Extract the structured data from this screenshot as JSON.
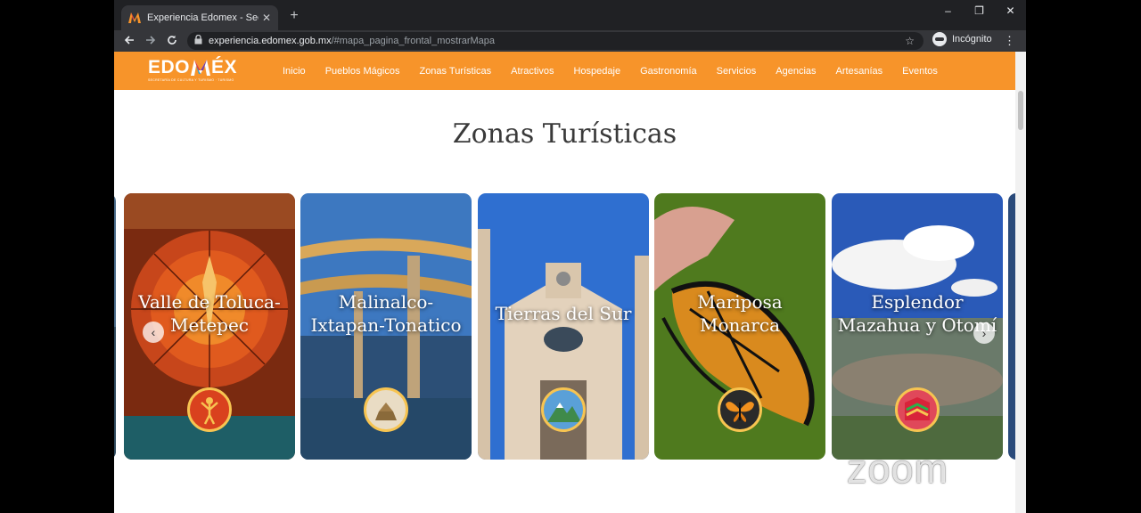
{
  "browser": {
    "tab_title": "Experiencia Edomex - Secretar",
    "tab_close": "✕",
    "new_tab": "+",
    "url_host": "experiencia.edomex.gob.mx",
    "url_path": "/#mapa_pagina_frontal_mostrarMapa",
    "profile_label": "Incógnito",
    "window_minimize": "–",
    "window_restore": "❐",
    "window_close": "✕"
  },
  "site": {
    "logo_left": "EDO",
    "logo_right": "ÉX",
    "logo_tagline": "SECRETARÍA DE CULTURA Y TURISMO · TURISMO",
    "nav": [
      "Inicio",
      "Pueblos Mágicos",
      "Zonas Turísticas",
      "Atractivos",
      "Hospedaje",
      "Gastronomía",
      "Servicios",
      "Agencias",
      "Artesanías",
      "Eventos"
    ]
  },
  "main": {
    "heading": "Zonas Turísticas",
    "cards": [
      {
        "title": "Valle de Toluca-Metepec",
        "emblem": "human-figure-icon"
      },
      {
        "title": "Malinalco-Ixtapan-Tonatico",
        "emblem": "temple-icon"
      },
      {
        "title": "Tierras del Sur",
        "emblem": "mountain-icon"
      },
      {
        "title": "Mariposa Monarca",
        "emblem": "butterfly-icon"
      },
      {
        "title": "Esplendor Mazahua y Otomí",
        "emblem": "textile-icon"
      }
    ],
    "prev_arrow": "‹",
    "next_arrow": "›"
  },
  "overlay": {
    "watermark": "zoom"
  },
  "colors": {
    "brand_orange": "#f7942a",
    "emblem_ring": "#f7c451"
  }
}
